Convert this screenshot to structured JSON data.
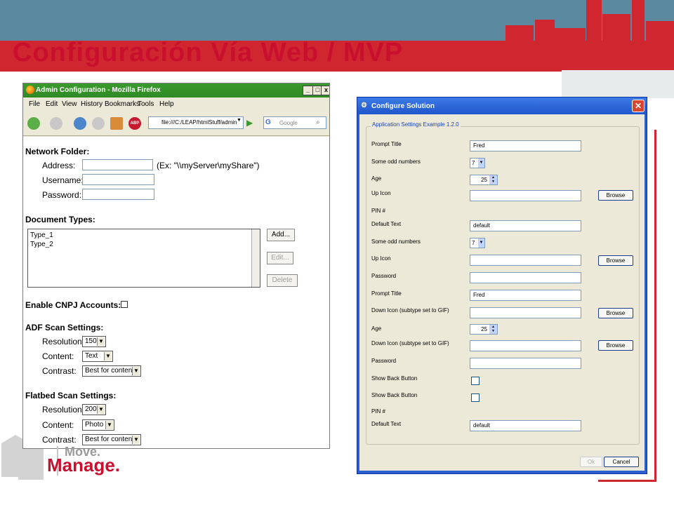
{
  "slide": {
    "title": "Configuración Vía Web / MVP",
    "logo_line1": "Move.",
    "logo_line2": "Manage."
  },
  "firefox": {
    "window_title": "Admin Configuration - Mozilla Firefox",
    "menu": [
      "File",
      "Edit",
      "View",
      "History",
      "Bookmarks",
      "Tools",
      "Help"
    ],
    "address": "file:///C:/LEAP/htmlStuff/admin",
    "search_placeholder": "Google",
    "network_folder": {
      "heading": "Network Folder:",
      "address_label": "Address:",
      "address_hint": "(Ex: \"\\\\myServer\\myShare\")",
      "username_label": "Username:",
      "password_label": "Password:"
    },
    "document_types": {
      "heading": "Document Types:",
      "items": [
        "Type_1",
        "Type_2"
      ],
      "add_label": "Add...",
      "edit_label": "Edit...",
      "delete_label": "Delete"
    },
    "cnpj_label": "Enable CNPJ Accounts:",
    "adf": {
      "heading": "ADF Scan Settings:",
      "resolution_label": "Resolution:",
      "resolution_value": "150",
      "content_label": "Content:",
      "content_value": "Text",
      "contrast_label": "Contrast:",
      "contrast_value": "Best for content"
    },
    "flatbed": {
      "heading": "Flatbed Scan Settings:",
      "resolution_label": "Resolution:",
      "resolution_value": "200",
      "content_label": "Content:",
      "content_value": "Photo",
      "contrast_label": "Contrast:",
      "contrast_value": "Best for content"
    }
  },
  "configure": {
    "window_title": "Configure Solution",
    "group_label": "Application Settings Example 1.2.0",
    "rows": [
      {
        "label": "Prompt Title",
        "value": "Fred"
      },
      {
        "label": "Some odd numbers",
        "value": "7"
      },
      {
        "label": "Age",
        "value": "25"
      },
      {
        "label": "Up Icon",
        "value": ""
      },
      {
        "label": "PIN #"
      },
      {
        "label": "Default Text",
        "value": "default"
      },
      {
        "label": "Some odd numbers",
        "value": "7"
      },
      {
        "label": "Up Icon",
        "value": ""
      },
      {
        "label": "Password",
        "value": ""
      },
      {
        "label": "Prompt Title",
        "value": "Fred"
      },
      {
        "label": "Down Icon (subtype set to GIF)",
        "value": ""
      },
      {
        "label": "Age",
        "value": "25"
      },
      {
        "label": "Down Icon (subtype set to GIF)",
        "value": ""
      },
      {
        "label": "Password",
        "value": ""
      },
      {
        "label": "Show Back Button"
      },
      {
        "label": "Show Back Button"
      },
      {
        "label": "PIN #"
      },
      {
        "label": "Default Text",
        "value": "default"
      }
    ],
    "browse_label": "Browse",
    "ok_label": "Ok",
    "cancel_label": "Cancel"
  },
  "colors": {
    "accent_red": "#c8102e",
    "sky": "#5b8aa0",
    "xp_blue": "#2a5fcf",
    "firefox_green": "#2f8a23"
  }
}
